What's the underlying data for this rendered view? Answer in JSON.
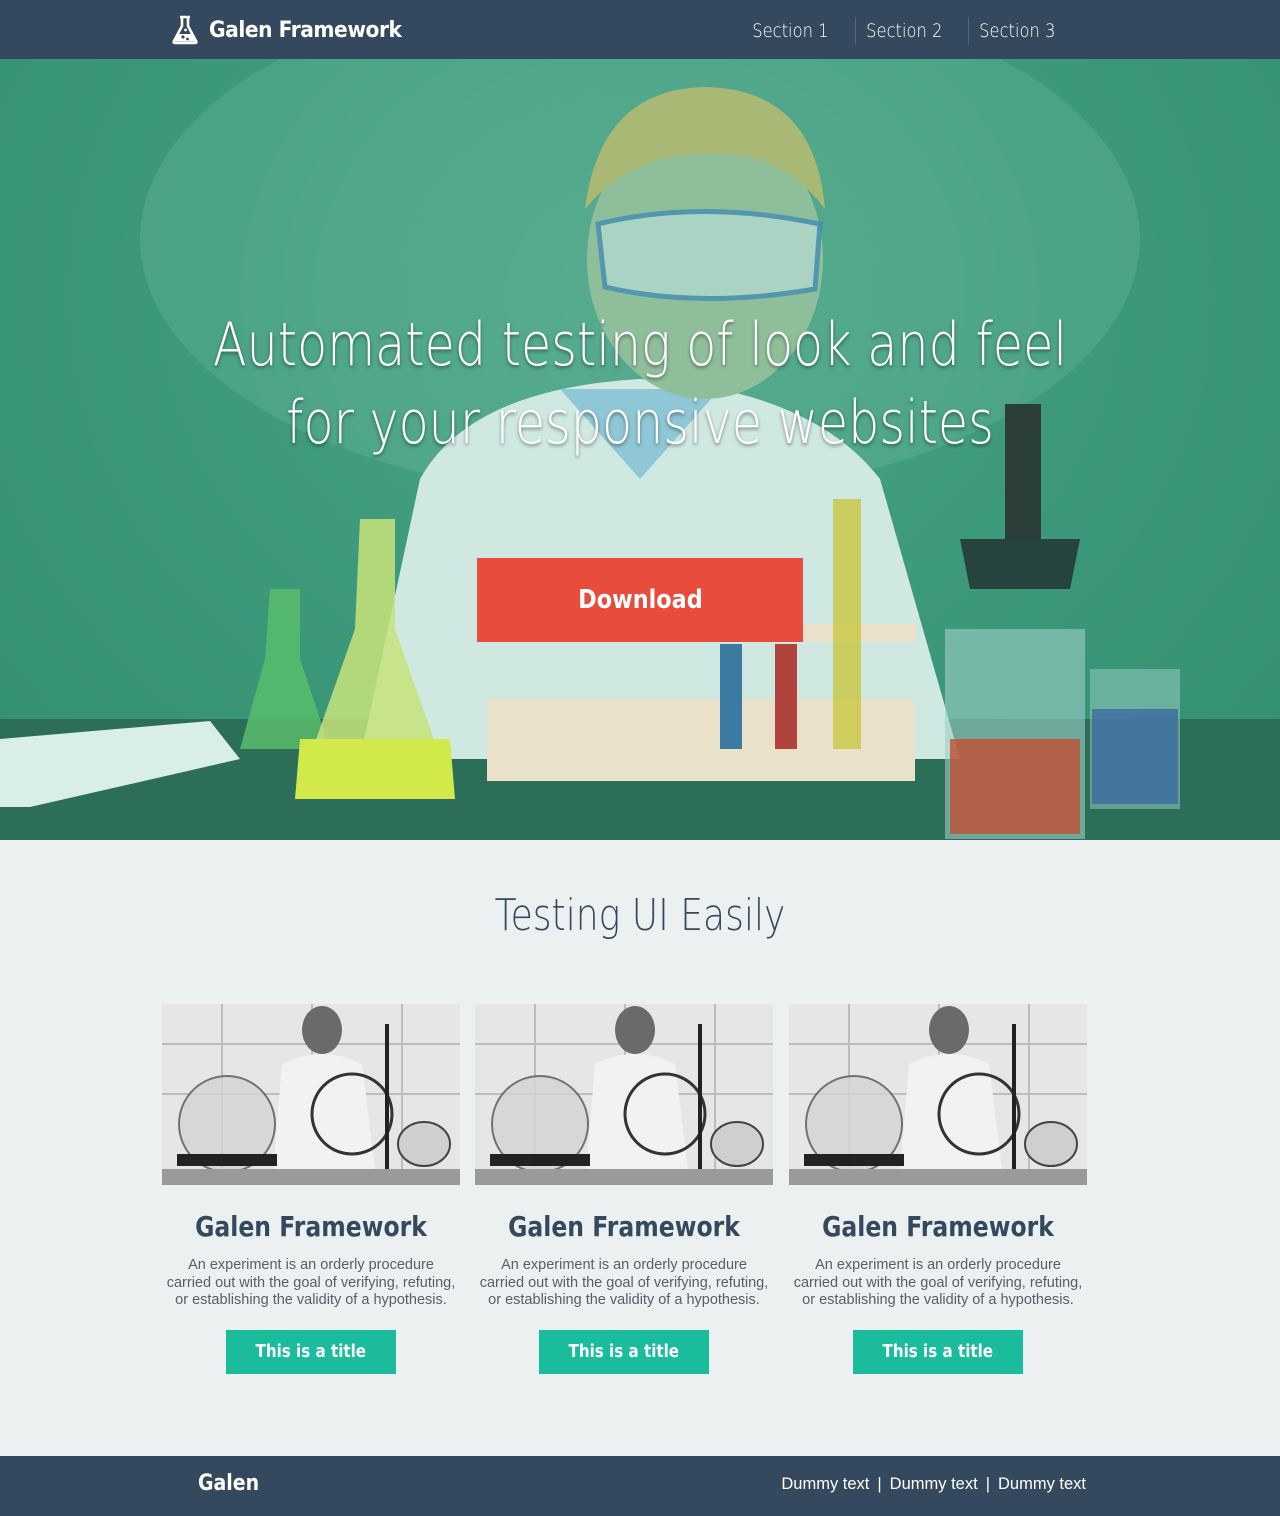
{
  "header": {
    "brand": "Galen Framework",
    "nav": [
      {
        "label": "Section 1"
      },
      {
        "label": "Section 2"
      },
      {
        "label": "Section 3"
      }
    ]
  },
  "hero": {
    "title_line1": "Automated testing of look and feel",
    "title_line2": "for your responsive websites",
    "download_label": "Download"
  },
  "features": {
    "title": "Testing UI Easily",
    "cards": [
      {
        "title": "Galen Framework",
        "text": "An experiment is an orderly procedure carried out with the goal of verifying, refuting, or establishing the validity of a hypothesis.",
        "button": "This is a title"
      },
      {
        "title": "Galen Framework",
        "text": "An experiment is an orderly procedure carried out with the goal of verifying, refuting, or establishing the validity of a hypothesis.",
        "button": "This is a title"
      },
      {
        "title": "Galen Framework",
        "text": "An experiment is an orderly procedure carried out with the goal of verifying, refuting, or establishing the validity of a hypothesis.",
        "button": "This is a title"
      }
    ]
  },
  "footer": {
    "brand": "Galen",
    "links": [
      "Dummy text",
      "Dummy text",
      "Dummy text"
    ],
    "separator": "|"
  },
  "colors": {
    "header_bg": "#34495e",
    "hero_overlay": "#3e9a7c",
    "download_button": "#e74c3c",
    "card_button": "#1abc9c",
    "page_bg": "#ecf0f1"
  },
  "icons": {
    "logo": "flask-icon"
  }
}
